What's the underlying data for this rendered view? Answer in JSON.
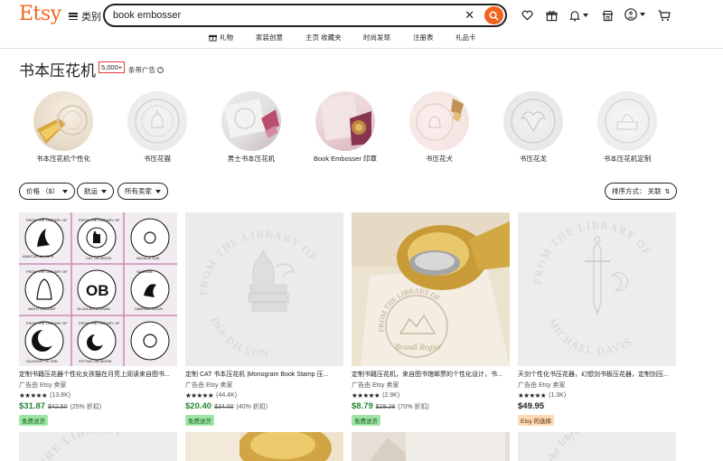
{
  "header": {
    "logo": "Etsy",
    "categories_label": "类别",
    "search": {
      "value": "book embosser"
    }
  },
  "nav": {
    "items": [
      {
        "label": "礼物",
        "icon": "gift-icon"
      },
      {
        "label": "家装创意"
      },
      {
        "label": "主页 收藏夹"
      },
      {
        "label": "时尚发现"
      },
      {
        "label": "注册表"
      },
      {
        "label": "礼品卡"
      }
    ]
  },
  "results": {
    "title": "书本压花机",
    "count": "5,000+",
    "ad_note": "条带广告"
  },
  "circles": [
    {
      "label": "书本压花机个性化"
    },
    {
      "label": "书压花猫"
    },
    {
      "label": "男士书本压花机"
    },
    {
      "label": "Book Embosser 印章"
    },
    {
      "label": "书压花犬"
    },
    {
      "label": "书压花龙"
    },
    {
      "label": "书本压花机定制"
    }
  ],
  "filters": {
    "price": "价格 （$）",
    "shipping": "航运",
    "sellers": "所有卖家",
    "sort": "排序方式： 关联"
  },
  "products": [
    {
      "title": "定制书籍压花器个性化女孩猫在月亮上阅读来自图书...",
      "seller": "广告由 Etsy 卖家",
      "stars": "★★★★★",
      "reviews": "(13.8K)",
      "price": "$31.87",
      "old_price": "$42.50",
      "discount": "(25% 折扣)",
      "badge": "免费送货",
      "thumb_text": {
        "tl_a": "FROM THE LIBRARY OF",
        "tl_b": "ANASTACIA POPE",
        "tm_a": "FROM THE LIBRARY OF",
        "tm_b": "CAT ON MOON",
        "tr_a": "NATALIA SUN",
        "ml_a": "FROM THE LIBRARY OF",
        "ml_b": "NIGHT READER",
        "mm_a": "OB",
        "mm_b": "OLIVIA BRADSHAW",
        "mr_a": "SABRINA MOON",
        "mr_b": "SABRINA",
        "bl_a": "FROM THE LIBRARY OF",
        "bl_b": "SILHOUETTE GIRL",
        "bm_a": "SITTING ON MOON",
        "bm_b": "FROM THE LIBRARY OF"
      }
    },
    {
      "title": "定制 CAT 书本压花机 |Monogram Book Stamp 压...",
      "seller": "广告由 Etsy 卖家",
      "stars": "★★★★★",
      "reviews": "(44.4K)",
      "price": "$20.40",
      "old_price": "$34.00",
      "discount": "(40% 折扣)",
      "badge": "免费送货",
      "thumb_text": {
        "top": "FROM THE LIBRARY OF",
        "bottom": "INA DILLON"
      }
    },
    {
      "title": "定制书籍压花机，来自图书馆邮票的个性化设计，书...",
      "seller": "广告由 Etsy 卖家",
      "stars": "★★★★★",
      "reviews": "(2.9K)",
      "price": "$8.79",
      "old_price": "$29.28",
      "discount": "(70% 折扣)",
      "badge": "免费送货",
      "thumb_text": {
        "top": "FROM THE LIBRARY OF",
        "bottom": "Brandi Regier"
      }
    },
    {
      "title": "天剑个性化书压花器，幻想剑书板压花器，定制剑压...",
      "seller": "广告由 Etsy 卖家",
      "stars": "★★★★★",
      "reviews": "(1.3K)",
      "price": "$49.95",
      "badge": "Etsy 的选择",
      "thumb_text": {
        "top": "FROM THE LIBRARY OF",
        "bottom": "MICHAEL DAVIS"
      }
    }
  ],
  "row2": {
    "thumb1": "THE LIBRARY",
    "thumb4": "the library"
  },
  "colors": {
    "brand": "#f1641e",
    "price_green": "#258635",
    "badge_green": "#9ee6a3",
    "badge_orange": "#fdd9b5",
    "highlight_red": "#e53935"
  }
}
